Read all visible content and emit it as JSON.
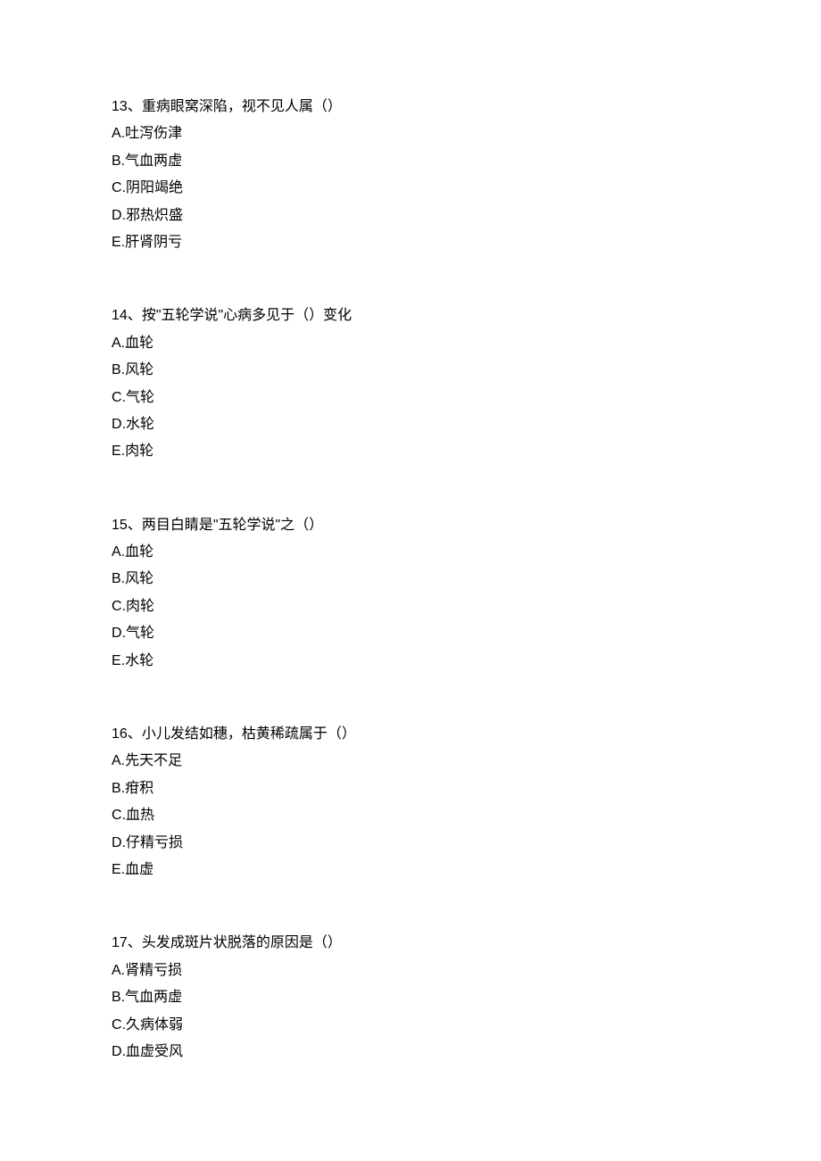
{
  "questions": [
    {
      "number": "13",
      "text": "重病眼窝深陷，视不见人属（）",
      "options": [
        {
          "letter": "A",
          "text": "吐泻伤津"
        },
        {
          "letter": "B",
          "text": "气血两虚"
        },
        {
          "letter": "C",
          "text": "阴阳竭绝"
        },
        {
          "letter": "D",
          "text": "邪热炽盛"
        },
        {
          "letter": "E",
          "text": "肝肾阴亏"
        }
      ]
    },
    {
      "number": "14",
      "text": "按\"五轮学说\"心病多见于（）变化",
      "options": [
        {
          "letter": "A",
          "text": "血轮"
        },
        {
          "letter": "B",
          "text": "风轮"
        },
        {
          "letter": "C",
          "text": "气轮"
        },
        {
          "letter": "D",
          "text": "水轮"
        },
        {
          "letter": "E",
          "text": "肉轮"
        }
      ]
    },
    {
      "number": "15",
      "text": "两目白睛是\"五轮学说\"之（）",
      "options": [
        {
          "letter": "A",
          "text": "血轮"
        },
        {
          "letter": "B",
          "text": "风轮"
        },
        {
          "letter": "C",
          "text": "肉轮"
        },
        {
          "letter": "D",
          "text": "气轮"
        },
        {
          "letter": "E",
          "text": "水轮"
        }
      ]
    },
    {
      "number": "16",
      "text": "小儿发结如穗，枯黄稀疏属于（）",
      "options": [
        {
          "letter": "A",
          "text": "先天不足"
        },
        {
          "letter": "B",
          "text": "疳积"
        },
        {
          "letter": "C",
          "text": "血热"
        },
        {
          "letter": "D",
          "text": "仔精亏损"
        },
        {
          "letter": "E",
          "text": "血虚"
        }
      ]
    },
    {
      "number": "17",
      "text": "头发成斑片状脱落的原因是（）",
      "options": [
        {
          "letter": "A",
          "text": "肾精亏损"
        },
        {
          "letter": "B",
          "text": "气血两虚"
        },
        {
          "letter": "C",
          "text": "久病体弱"
        },
        {
          "letter": "D",
          "text": "血虚受风"
        }
      ]
    }
  ]
}
